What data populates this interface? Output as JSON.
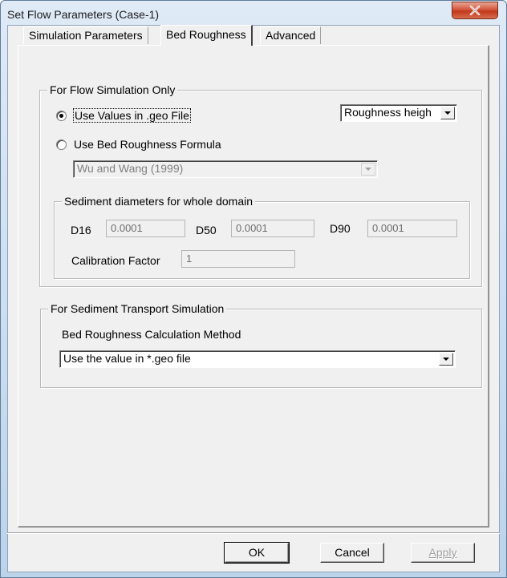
{
  "window": {
    "title": "Set Flow Parameters (Case-1)",
    "close_icon": "close-icon"
  },
  "tabs": [
    {
      "label": "Simulation Parameters",
      "active": false
    },
    {
      "label": "Bed Roughness",
      "active": true
    },
    {
      "label": "Advanced",
      "active": false
    }
  ],
  "flow_group": {
    "title": "For Flow Simulation Only",
    "radio_geo": {
      "label": "Use Values in .geo File",
      "checked": true
    },
    "radio_formula": {
      "label": "Use Bed Roughness Formula",
      "checked": false
    },
    "roughness_type": {
      "value": "Roughness heigh"
    },
    "formula_select": {
      "value": "Wu and Wang (1999)",
      "enabled": false
    },
    "sediment_group": {
      "title": "Sediment diameters for whole domain",
      "d16": {
        "label": "D16",
        "value": "0.0001"
      },
      "d50": {
        "label": "D50",
        "value": "0.0001"
      },
      "d90": {
        "label": "D90",
        "value": "0.0001"
      },
      "calibration": {
        "label": "Calibration Factor",
        "value": "1"
      }
    }
  },
  "sediment_transport_group": {
    "title": "For Sediment Transport Simulation",
    "method_label": "Bed Roughness Calculation Method",
    "method_select": {
      "value": "Use the value in *.geo file"
    }
  },
  "buttons": {
    "ok": "OK",
    "cancel": "Cancel",
    "apply": "Apply"
  },
  "colors": {
    "close_button": "#c1381a",
    "dialog_face": "#f0f0f0",
    "frame": "#cddff1"
  }
}
